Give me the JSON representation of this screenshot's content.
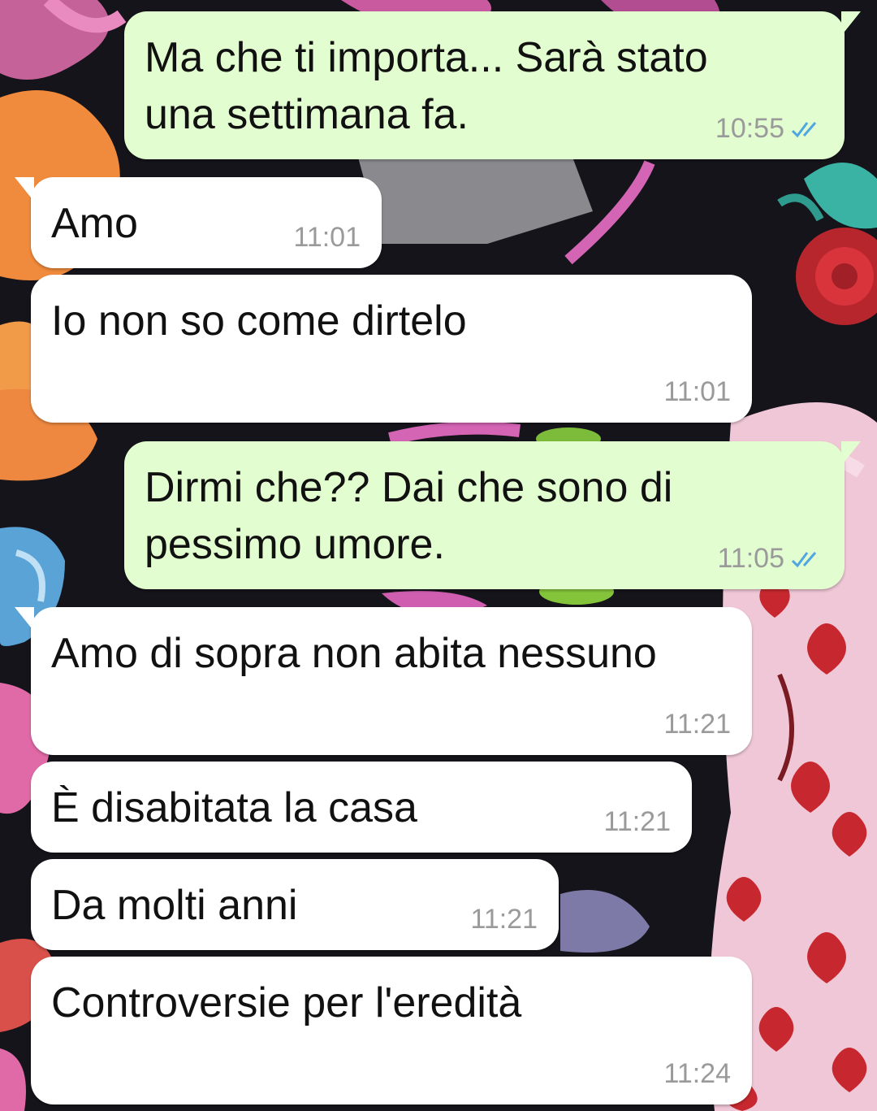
{
  "chat": {
    "messages": [
      {
        "direction": "out",
        "text": "Ma che ti importa... Sarà stato\nuna settimana fa.",
        "time": "10:55",
        "read_receipt": "double-check-icon"
      },
      {
        "direction": "in",
        "text": "Amo",
        "time": "11:01"
      },
      {
        "direction": "in",
        "text": "Io non so come dirtelo",
        "time": "11:01"
      },
      {
        "direction": "out",
        "text": "Dirmi che?? Dai che sono di\npessimo umore.",
        "time": "11:05",
        "read_receipt": "double-check-icon"
      },
      {
        "direction": "in",
        "text": "Amo di sopra non abita nessuno",
        "time": "11:21"
      },
      {
        "direction": "in",
        "text": "È disabitata la casa",
        "time": "11:21"
      },
      {
        "direction": "in",
        "text": "Da molti anni",
        "time": "11:21"
      },
      {
        "direction": "in",
        "text": "Controversie per l'eredità",
        "time": "11:24"
      }
    ]
  },
  "colors": {
    "outgoing_bubble": "#e2fdcf",
    "incoming_bubble": "#ffffff",
    "read_check": "#4fa6e0",
    "timestamp": "#9a9a9a",
    "wallpaper_base": "#14141a"
  }
}
